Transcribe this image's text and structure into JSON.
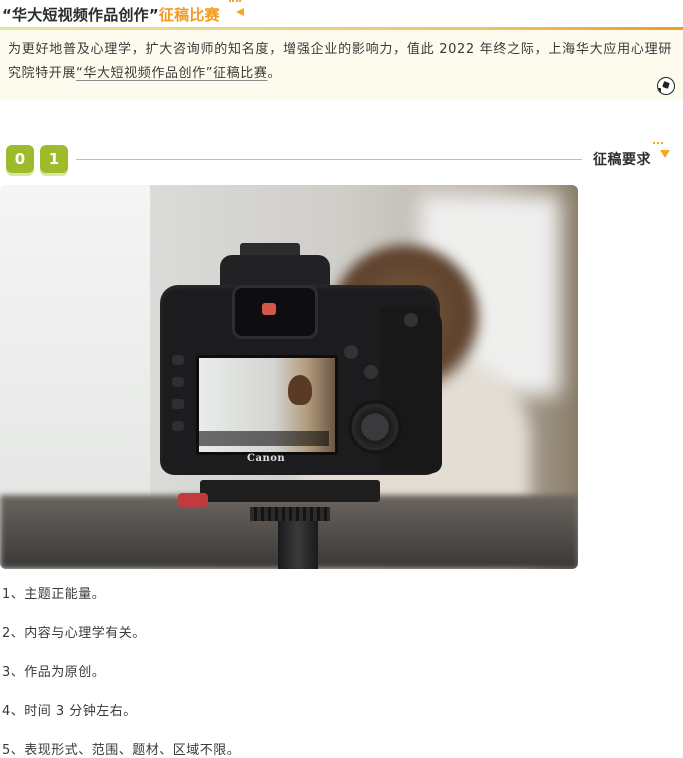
{
  "header": {
    "title_main": "“华大短视频作品创作”",
    "title_accent": "征稿比赛",
    "accent_color": "#f29b1f"
  },
  "intro": {
    "text_before": "为更好地普及心理学，扩大咨询师的知名度，增强企业的影响力，值此 2022 年终之际，上海华大应用心理研究院特开展",
    "text_underlined": "“华大短视频作品创作”征稿比赛",
    "text_after": "。",
    "background_color": "#fdfbee"
  },
  "section": {
    "digits": [
      "0",
      "1"
    ],
    "title": "征稿要求",
    "badge_color": "#9dbb2a"
  },
  "photo": {
    "alt": "camera-on-tripod-photo",
    "camera_brand": "Canon"
  },
  "requirements": [
    "1、主题正能量。",
    "2、内容与心理学有关。",
    "3、作品为原创。",
    "4、时间 3 分钟左右。",
    "5、表现形式、范围、题材、区域不限。"
  ]
}
